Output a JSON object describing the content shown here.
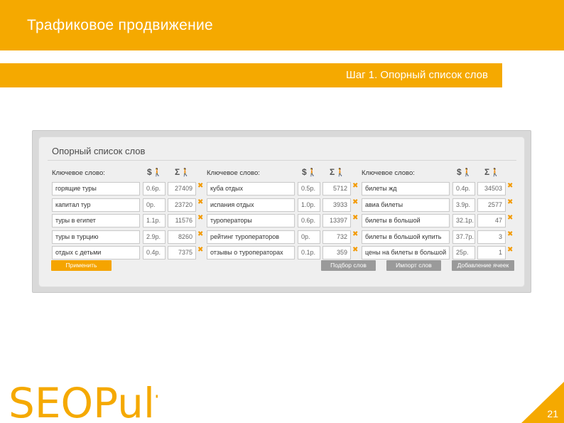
{
  "slide": {
    "title": "Трафиковое продвижение",
    "step": "Шаг 1. Опорный список слов",
    "page_number": "21",
    "logo_text": "SEOPult",
    "brand_color": "#f5a900"
  },
  "panel": {
    "title": "Опорный список слов",
    "keyword_header": "Ключевое слово:",
    "price_header": "$",
    "count_header": "Σ",
    "columns": [
      {
        "rows": [
          {
            "word": "горящие туры",
            "price": "0.6р.",
            "count": "27409"
          },
          {
            "word": "капитал тур",
            "price": "0р.",
            "count": "23720"
          },
          {
            "word": "туры в египет",
            "price": "1.1р.",
            "count": "11576"
          },
          {
            "word": "туры в турцию",
            "price": "2.9р.",
            "count": "8260"
          },
          {
            "word": "отдых с детьми",
            "price": "0.4р.",
            "count": "7375"
          }
        ]
      },
      {
        "rows": [
          {
            "word": "куба отдых",
            "price": "0.5р.",
            "count": "5712"
          },
          {
            "word": "испания отдых",
            "price": "1.0р.",
            "count": "3933"
          },
          {
            "word": "туроператоры",
            "price": "0.6р.",
            "count": "13397"
          },
          {
            "word": "рейтинг туроператоров",
            "price": "0р.",
            "count": "732"
          },
          {
            "word": "отзывы о туроператорах",
            "price": "0.1р.",
            "count": "359"
          }
        ]
      },
      {
        "rows": [
          {
            "word": "билеты жд",
            "price": "0.4р.",
            "count": "34503"
          },
          {
            "word": "авиа билеты",
            "price": "3.9р.",
            "count": "2577"
          },
          {
            "word": "билеты в большой",
            "price": "32.1р.",
            "count": "47"
          },
          {
            "word": "билеты в большой купить",
            "price": "37.7р.",
            "count": "3"
          },
          {
            "word": "цены на билеты в большой",
            "price": "25р.",
            "count": "1"
          }
        ]
      }
    ],
    "buttons": {
      "apply": "Применить",
      "select_words": "Подбор слов",
      "import_words": "Импорт слов",
      "add_cells": "Добавление ячеек"
    }
  }
}
